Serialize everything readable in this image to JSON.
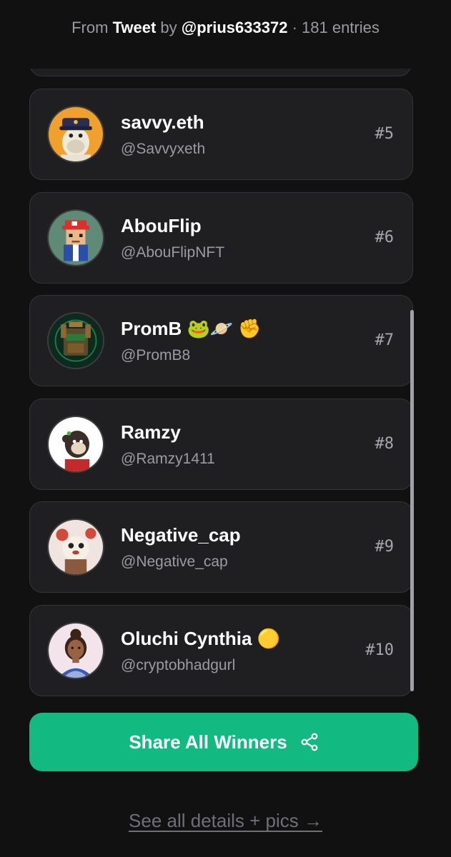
{
  "header": {
    "prefix": "From",
    "source": "Tweet",
    "by": "by",
    "author": "@prius633372",
    "separator": "·",
    "entries": "181 entries"
  },
  "winners": [
    {
      "name": "savvy.eth",
      "handle": "@Savvyxeth",
      "rank": "#5",
      "avatar": "ape-captain-hat-icon"
    },
    {
      "name": "AbouFlip",
      "handle": "@AbouFlipNFT",
      "rank": "#6",
      "avatar": "pixel-character-red-cap-icon"
    },
    {
      "name": "PromB 🐸🪐 ✊",
      "handle": "@PromB8",
      "rank": "#7",
      "avatar": "robot-machine-icon"
    },
    {
      "name": "Ramzy",
      "handle": "@Ramzy1411",
      "rank": "#8",
      "avatar": "ape-sketch-icon"
    },
    {
      "name": "Negative_cap",
      "handle": "@Negative_cap",
      "rank": "#9",
      "avatar": "bear-cartoon-icon"
    },
    {
      "name": "Oluchi Cynthia 🟡",
      "handle": "@cryptobhadgurl",
      "rank": "#10",
      "avatar": "woman-portrait-icon"
    }
  ],
  "share_button": {
    "label": "Share All Winners",
    "icon": "share-icon"
  },
  "details_link": "See all details + pics →",
  "colors": {
    "background": "#111112",
    "card": "#1f1f21",
    "accent": "#12b981"
  }
}
